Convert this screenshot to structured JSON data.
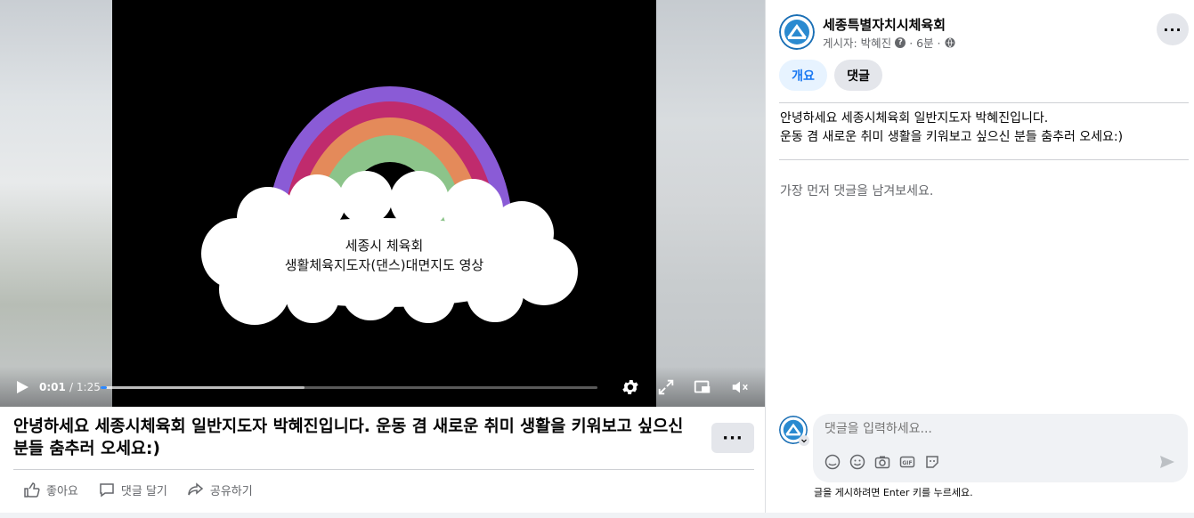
{
  "video": {
    "overlay_line1": "세종시 체육회",
    "overlay_line2": "생활체육지도자(댄스)대면지도 영상",
    "time_current": "0:01",
    "time_total": "/ 1:25",
    "progress_played": 0.013,
    "progress_buffered": 0.41,
    "rainbow_colors": [
      "#8a5bd6",
      "#c02b6d",
      "#e48a5a",
      "#8cc48a"
    ]
  },
  "post": {
    "title": "안녕하세요 세종시체육회 일반지도자 박혜진입니다. 운동 겸 새로운 취미 생활을 키워보고 싶으신 분들 춤추러 오세요:)",
    "more_label": "···",
    "actions": {
      "like": "좋아요",
      "comment": "댓글 달기",
      "share": "공유하기"
    }
  },
  "sidebar": {
    "page_name": "세종특별자치시체육회",
    "posted_by": "게시자: 박혜진",
    "question_mark": "?",
    "time_ago": "· 6분 ·",
    "more_label": "···",
    "tabs": {
      "overview": "개요",
      "comments": "댓글"
    },
    "description_line1": "안녕하세요 세종시체육회 일반지도자 박혜진입니다.",
    "description_line2": "운동 겸 새로운 취미 생활을 키워보고 싶으신 분들 춤추러 오세요:)",
    "first_comment_prompt": "가장 먼저 댓글을 남겨보세요.",
    "comment_placeholder": "댓글을 입력하세요...",
    "enter_hint": "글을 게시하려면 Enter 키를 누르세요."
  },
  "colors": {
    "accent": "#1877f2",
    "progress": "#2d88ff",
    "muted_text": "#65676b"
  }
}
